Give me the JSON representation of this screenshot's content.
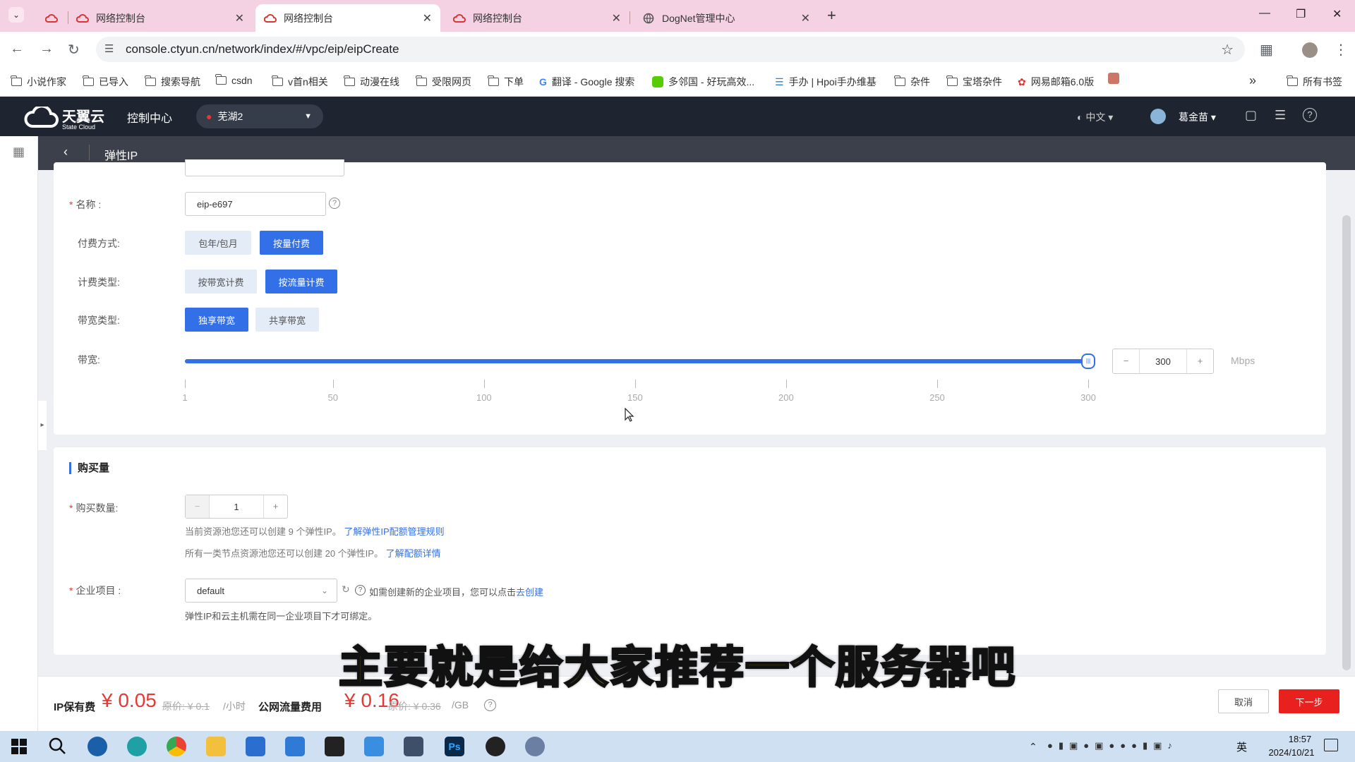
{
  "browser": {
    "tabs": [
      {
        "title": "",
        "active": false
      },
      {
        "title": "网络控制台",
        "active": false
      },
      {
        "title": "网络控制台",
        "active": true
      },
      {
        "title": "网络控制台",
        "active": false
      },
      {
        "title": "DogNet管理中心",
        "active": false
      }
    ],
    "url": "console.ctyun.cn/network/index/#/vpc/eip/eipCreate",
    "bookmarks": [
      "小说作家",
      "已导入",
      "搜索导航",
      "csdn",
      "v首n相关",
      "动漫在线",
      "受限网页",
      "下单",
      "翻译 - Google 搜索",
      "多邻国 - 好玩高效...",
      "手办 | Hpoi手办维基",
      "杂件",
      "宝塔杂件",
      "网易邮箱6.0版"
    ],
    "all_bookmarks": "所有书签"
  },
  "console": {
    "logo": "天翼云",
    "logo_sub": "State Cloud",
    "control_center": "控制中心",
    "region": "芜湖2",
    "language": "中文",
    "user": "葛金苗",
    "page_title": "弹性IP"
  },
  "form": {
    "name_label": "名称 :",
    "name_value": "eip-e697",
    "pay_label": "付费方式:",
    "pay_options": [
      "包年/包月",
      "按量付费"
    ],
    "billing_label": "计费类型:",
    "billing_options": [
      "按带宽计费",
      "按流量计费"
    ],
    "bwtype_label": "带宽类型:",
    "bwtype_options": [
      "独享带宽",
      "共享带宽"
    ],
    "bandwidth_label": "带宽:",
    "bandwidth_value": "300",
    "bandwidth_unit": "Mbps",
    "bandwidth_fraction": 1.0,
    "ticks": [
      "1",
      "50",
      "100",
      "150",
      "200",
      "250",
      "300"
    ]
  },
  "purchase": {
    "section_title": "购买量",
    "qty_label": "购买数量:",
    "qty_value": "1",
    "note1": "当前资源池您还可以创建 9 个弹性IP。",
    "note1_link": "了解弹性IP配额管理规则",
    "note2": "所有一类节点资源池您还可以创建 20 个弹性IP。",
    "note2_link": "了解配额详情",
    "project_label": "企业项目 :",
    "project_value": "default",
    "project_hint": "如需创建新的企业项目，您可以点击",
    "project_link": "去创建",
    "project_note": "弹性IP和云主机需在同一企业项目下才可绑定。"
  },
  "footer": {
    "ip_fee_label": "IP保有费",
    "ip_fee": "¥ 0.05",
    "ip_orig": "原价: ¥ 0.1",
    "ip_unit": "/小时",
    "traffic_label": "公网流量费用",
    "traffic_fee": "¥ 0.16",
    "traffic_orig": "原价: ¥ 0.36",
    "traffic_unit": "/GB",
    "cancel": "取消",
    "next": "下一步"
  },
  "subtitle": "主要就是给大家推荐一个服务器吧",
  "taskbar": {
    "ime": "英",
    "time": "18:57",
    "date": "2024/10/21"
  },
  "colors": {
    "accent": "#3370e8",
    "price": "#e53935",
    "next_button": "#e8211e"
  }
}
